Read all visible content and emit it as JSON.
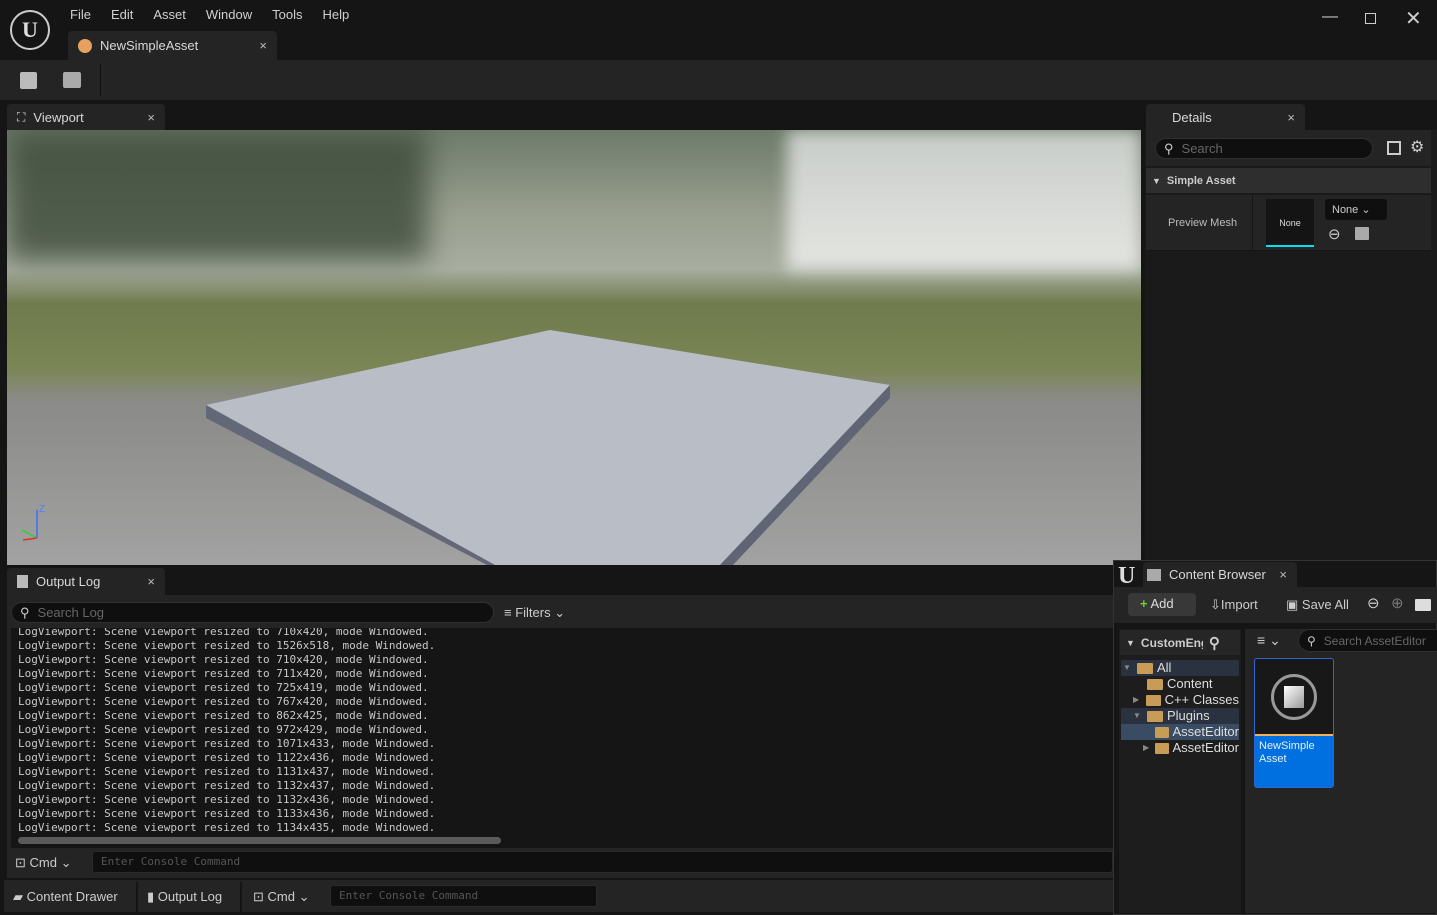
{
  "menu": [
    "File",
    "Edit",
    "Asset",
    "Window",
    "Tools",
    "Help"
  ],
  "document_tab": "NewSimpleAsset",
  "viewport": {
    "tab": "Viewport",
    "axis_z": "Z"
  },
  "details": {
    "tab": "Details",
    "search_placeholder": "Search",
    "category": "Simple Asset",
    "property_label": "Preview Mesh",
    "thumbnail_text": "None",
    "dropdown_value": "None"
  },
  "output_log": {
    "tab": "Output Log",
    "search_placeholder": "Search Log",
    "filters": "Filters",
    "lines": [
      "LogViewport: Scene viewport resized to 710x420, mode Windowed.",
      "LogViewport: Scene viewport resized to 1526x518, mode Windowed.",
      "LogViewport: Scene viewport resized to 710x420, mode Windowed.",
      "LogViewport: Scene viewport resized to 711x420, mode Windowed.",
      "LogViewport: Scene viewport resized to 725x419, mode Windowed.",
      "LogViewport: Scene viewport resized to 767x420, mode Windowed.",
      "LogViewport: Scene viewport resized to 862x425, mode Windowed.",
      "LogViewport: Scene viewport resized to 972x429, mode Windowed.",
      "LogViewport: Scene viewport resized to 1071x433, mode Windowed.",
      "LogViewport: Scene viewport resized to 1122x436, mode Windowed.",
      "LogViewport: Scene viewport resized to 1131x437, mode Windowed.",
      "LogViewport: Scene viewport resized to 1132x437, mode Windowed.",
      "LogViewport: Scene viewport resized to 1132x436, mode Windowed.",
      "LogViewport: Scene viewport resized to 1133x436, mode Windowed.",
      "LogViewport: Scene viewport resized to 1134x435, mode Windowed."
    ],
    "cmd_label": "Cmd",
    "console_placeholder": "Enter Console Command"
  },
  "status_bar": {
    "content_drawer": "Content Drawer",
    "output_log": "Output Log",
    "cmd": "Cmd",
    "console_placeholder": "Enter Console Command"
  },
  "content_browser": {
    "tab": "Content Browser",
    "add": "Add",
    "import": "Import",
    "save_all": "Save All",
    "source_title": "CustomEng",
    "search_placeholder": "Search AssetEditor",
    "tree": [
      {
        "label": "All",
        "indent": 0,
        "arrow": "down",
        "type": "folder-open",
        "selected": false,
        "band": true
      },
      {
        "label": "Content",
        "indent": 1,
        "arrow": "",
        "type": "folder",
        "selected": false
      },
      {
        "label": "C++ Classes",
        "indent": 1,
        "arrow": "right",
        "type": "cpp"
      },
      {
        "label": "Plugins",
        "indent": 1,
        "arrow": "down",
        "type": "folder-open",
        "band": true
      },
      {
        "label": "AssetEditor",
        "indent": 2,
        "arrow": "",
        "type": "folder",
        "selected": true
      },
      {
        "label": "AssetEditor",
        "indent": 2,
        "arrow": "right",
        "type": "cpp"
      }
    ],
    "asset_name": "NewSimple Asset"
  },
  "colors": {
    "accent": "#0070e0",
    "selection_underline": "#00e0f0",
    "asset_stripe": "#f0b060",
    "add_plus": "#6fcf3c"
  }
}
